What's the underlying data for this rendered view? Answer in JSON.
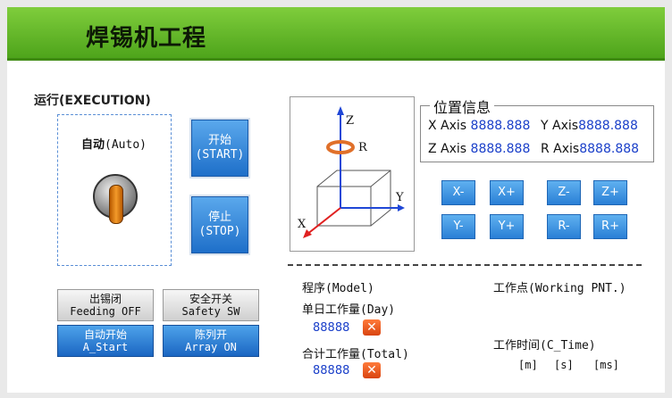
{
  "header": {
    "title": "焊锡机工程"
  },
  "execution": {
    "label": "运行(EXECUTION)",
    "auto_label_cn": "自动",
    "auto_label_en": "(Auto)",
    "start_cn": "开始",
    "start_en": "(START)",
    "stop_cn": "停止",
    "stop_en": "(STOP)"
  },
  "bottom_buttons": {
    "feeding_cn": "出锡闭",
    "feeding_en": "Feeding OFF",
    "safety_cn": "安全开关",
    "safety_en": "Safety SW",
    "astart_cn": "自动开始",
    "astart_en": "A_Start",
    "array_cn": "陈列开",
    "array_en": "Array ON"
  },
  "axis_diagram": {
    "z": "Z",
    "r": "R",
    "y": "Y",
    "x": "X"
  },
  "position": {
    "title": "位置信息",
    "x_label": "X Axis",
    "x_value": "8888.888",
    "y_label": "Y Axis",
    "y_value": "8888.888",
    "z_label": "Z Axis",
    "z_value": "8888.888",
    "r_label": "R Axis",
    "r_value": "8888.888"
  },
  "jog": {
    "x_minus": "X-",
    "x_plus": "X+",
    "z_minus": "Z-",
    "z_plus": "Z+",
    "y_minus": "Y-",
    "y_plus": "Y+",
    "r_minus": "R-",
    "r_plus": "R+"
  },
  "info": {
    "model_label": "程序(Model)",
    "day_label": "单日工作量(Day)",
    "day_value": "88888",
    "total_label": "合计工作量(Total)",
    "total_value": "88888",
    "reset_symbol": "✕",
    "point_label": "工作点(Working PNT.)",
    "time_label": "工作时间(C_Time)",
    "unit_m": "[m]",
    "unit_s": "[s]",
    "unit_ms": "[ms]"
  }
}
